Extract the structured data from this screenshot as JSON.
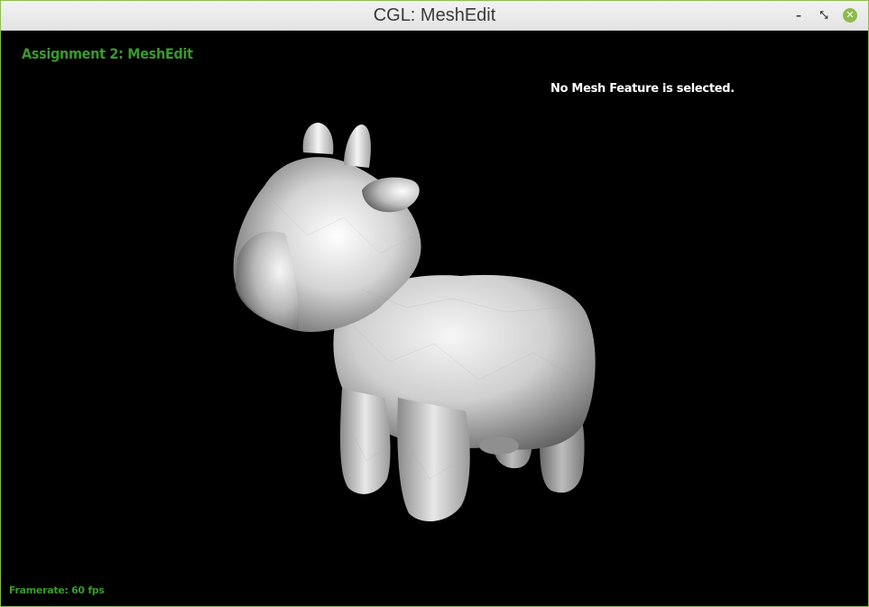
{
  "window": {
    "title": "CGL: MeshEdit",
    "minimize_glyph": "–",
    "maximize_glyph": "⤡",
    "close_glyph": "✕",
    "accent_color": "#8bbd4c"
  },
  "overlay": {
    "assignment_title": "Assignment 2: MeshEdit",
    "selection_status": "No Mesh Feature is selected.",
    "framerate": "Framerate: 60 fps",
    "title_color": "#3a9a2e",
    "status_color": "#ffffff"
  },
  "viewport": {
    "background": "#000000",
    "model": "cow-mesh"
  }
}
